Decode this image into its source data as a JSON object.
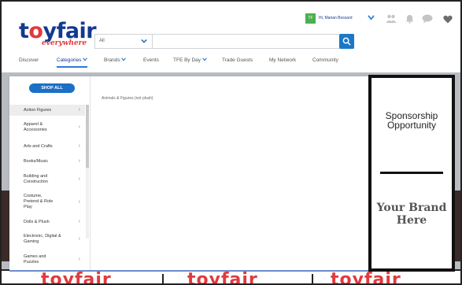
{
  "logo": {
    "main_a": "t",
    "main_o": "o",
    "main_b": "yfair",
    "sub": "everywhere"
  },
  "search": {
    "category": "All",
    "placeholder": "",
    "value": ""
  },
  "user": {
    "initials": "TF",
    "greeting": "Hi, Marian Bossard"
  },
  "icons": [
    "people-icon",
    "bell-icon",
    "chat-icon",
    "heart-icon"
  ],
  "nav": {
    "items": [
      "Discover",
      "Categories",
      "Brands",
      "Events",
      "TFE By Day",
      "Trade Guests",
      "My Network",
      "Community"
    ]
  },
  "menu": {
    "shop_all": "SHOP ALL",
    "categories": [
      "Action Figures",
      "Apparel & Accessories",
      "Arts and Crafts",
      "Books/Music",
      "Building and Construction",
      "Costume, Pretend & Role Play",
      "Dolls & Plush",
      "Electronic, Digital & Gaming",
      "Games and Puzzles"
    ],
    "subcategory": "Animals & Figures (not plush)"
  },
  "sponsor": {
    "title": "Sponsorship Opportunity",
    "brand": "Your Brand Here"
  },
  "background": {
    "banner_word": "toyfair"
  },
  "colors": {
    "brand_blue": "#123a8f",
    "brand_red": "#e03a3e",
    "accent": "#1b78c8",
    "avatar": "#4caf50"
  }
}
